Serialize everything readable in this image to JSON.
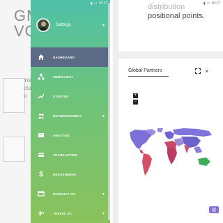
{
  "left_screen": {
    "background_title": "GMVO",
    "background_body": "Yobctubo",
    "status_time": "10:17",
    "drawer": {
      "profile_label": "Settings",
      "items": [
        {
          "label": "DASHBOARD",
          "icon": "home-icon",
          "active": true,
          "has_chevron": false
        },
        {
          "label": "SEMIOLOGY",
          "icon": "network-icon",
          "active": false,
          "has_chevron": false
        },
        {
          "label": "STARTUP",
          "icon": "trend-icon",
          "active": false,
          "has_chevron": false
        },
        {
          "label": "NETWORKEMENT",
          "icon": "people-icon",
          "active": false,
          "has_chevron": true
        },
        {
          "label": "ANALYSIS",
          "icon": "inbox-icon",
          "active": false,
          "has_chevron": false
        },
        {
          "label": "TRANSACTION",
          "icon": "card-icon",
          "active": false,
          "has_chevron": false
        },
        {
          "label": "ENCASHMENT",
          "icon": "dollar-icon",
          "active": false,
          "has_chevron": false
        },
        {
          "label": "PRODUCT OC",
          "icon": "box-icon",
          "active": false,
          "has_chevron": true
        },
        {
          "label": "TRAVEL OC",
          "icon": "plane-icon",
          "active": false,
          "has_chevron": true
        }
      ]
    },
    "colors": {
      "drawer_top": "#4fc1a8",
      "drawer_bottom": "#8ac25b",
      "active_item": "#5b6b86"
    }
  },
  "right_screen": {
    "status_time": "10:17",
    "top_card": {
      "line1": "distribution",
      "line2": "positional points."
    },
    "main_card": {
      "title": "Global Partners",
      "zoom_in": "+",
      "zoom_out": "−",
      "close": "×"
    },
    "colors": {
      "fab": "#8a6fd6"
    }
  }
}
